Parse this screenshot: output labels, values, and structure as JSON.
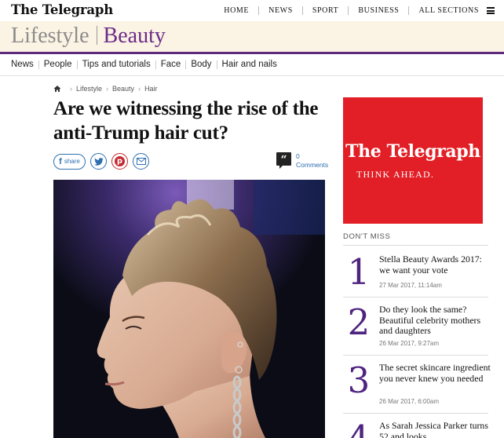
{
  "header": {
    "logo": "The Telegraph",
    "nav": [
      "HOME",
      "NEWS",
      "SPORT",
      "BUSINESS",
      "ALL SECTIONS"
    ]
  },
  "section": {
    "parent": "Lifestyle",
    "name": "Beauty"
  },
  "subnav": [
    "News",
    "People",
    "Tips and tutorials",
    "Face",
    "Body",
    "Hair and nails"
  ],
  "breadcrumb": [
    "Lifestyle",
    "Beauty",
    "Hair"
  ],
  "article": {
    "headline": "Are we witnessing the rise of the anti-Trump hair cut?",
    "share_label": "share",
    "comments_count": "0",
    "comments_label": "Comments"
  },
  "ad": {
    "logo": "The Telegraph",
    "tagline": "THINK AHEAD."
  },
  "dont_miss": {
    "title": "DON'T MISS",
    "items": [
      {
        "num": "1",
        "title": "Stella Beauty Awards 2017: we want your vote",
        "date": "27 Mar 2017, 11:14am"
      },
      {
        "num": "2",
        "title": "Do they look the same? Beautiful celebrity mothers and daughters",
        "date": "26 Mar 2017, 9:27am"
      },
      {
        "num": "3",
        "title": "The secret skincare ingredient you never knew you needed",
        "date": "26 Mar 2017, 6:00am"
      },
      {
        "num": "4",
        "title": "As Sarah Jessica Parker turns 52 and looks",
        "date": ""
      }
    ]
  },
  "colors": {
    "brand_purple": "#5e2b7c",
    "beauty_purple": "#6b2c88",
    "banner_bg": "#fbf3e3",
    "ad_red": "#e21f26",
    "link_blue": "#2e6fb0"
  }
}
